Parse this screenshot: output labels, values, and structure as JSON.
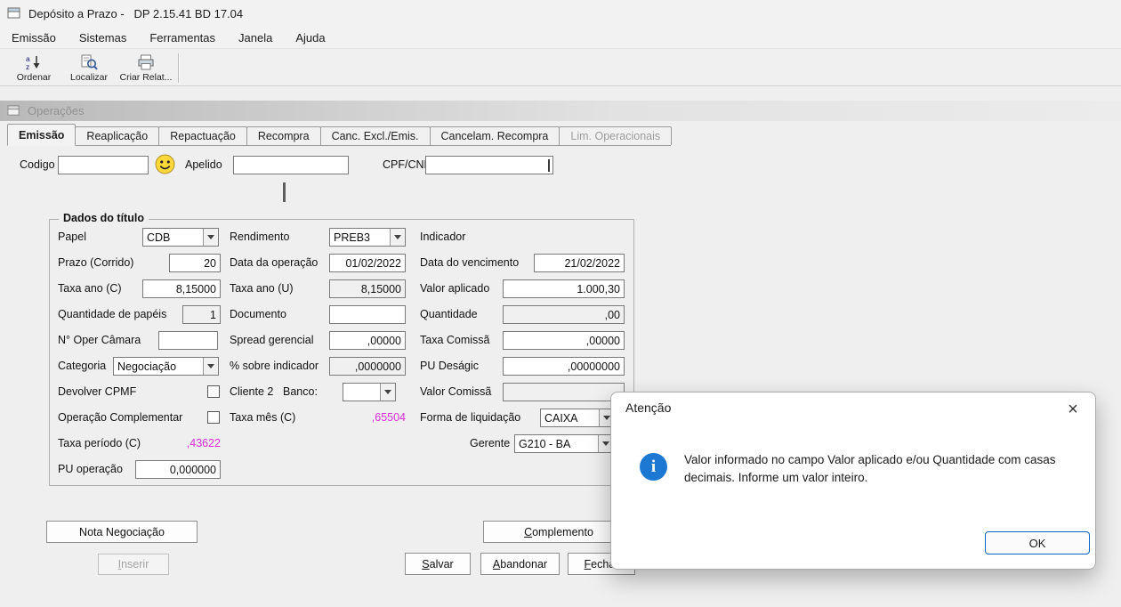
{
  "titlebar": {
    "title": "Depósito a Prazo -   DP 2.15.41 BD 17.04"
  },
  "menubar": {
    "items": [
      "Emissão",
      "Sistemas",
      "Ferramentas",
      "Janela",
      "Ajuda"
    ]
  },
  "toolbar": {
    "buttons": [
      "Ordenar",
      "Localizar",
      "Criar Relat..."
    ]
  },
  "operacoes": {
    "title": "Operações",
    "tabs": [
      "Emissão",
      "Reaplicação",
      "Repactuação",
      "Recompra",
      "Canc. Excl./Emis.",
      "Cancelam. Recompra",
      "Lim. Operacionais"
    ]
  },
  "header": {
    "codigo": {
      "label": "Codigo",
      "value": ""
    },
    "apelido": {
      "label": "Apelido",
      "value": ""
    },
    "cpf_cnpj": {
      "label": "CPF/CNPJ",
      "value": ""
    }
  },
  "dados": {
    "group_title": "Dados do título",
    "papel": {
      "label": "Papel",
      "value": "CDB"
    },
    "rendimento": {
      "label": "Rendimento",
      "value": "PREB3"
    },
    "indicador_label": "Indicador",
    "prazo": {
      "label": "Prazo (Corrido)",
      "value": "20"
    },
    "data_operacao": {
      "label": "Data da operação",
      "value": "01/02/2022"
    },
    "data_vencimento": {
      "label": "Data do vencimento",
      "value": "21/02/2022"
    },
    "taxa_ano_c": {
      "label": "Taxa ano (C)",
      "value": "8,15000"
    },
    "taxa_ano_u": {
      "label": "Taxa ano (U)",
      "value": "8,15000"
    },
    "valor_aplicado": {
      "label": "Valor aplicado",
      "value": "1.000,30"
    },
    "quantidade_papeis": {
      "label": "Quantidade de papéis",
      "value": "1"
    },
    "documento": {
      "label": "Documento",
      "value": ""
    },
    "quantidade": {
      "label": "Quantidade",
      "value": ",00"
    },
    "oper_camara": {
      "label": "N° Oper Câmara",
      "value": ""
    },
    "spread_gerencial": {
      "label": "Spread gerencial",
      "value": ",00000"
    },
    "taxa_comissao": {
      "label": "Taxa Comissã",
      "value": ",00000"
    },
    "categoria": {
      "label": "Categoria",
      "value": "Negociação"
    },
    "sobre_indicador": {
      "label": "% sobre indicador",
      "value": ",0000000"
    },
    "pu_desagio": {
      "label": "PU Deságic",
      "value": ",00000000"
    },
    "devolver_cpmf": {
      "label": "Devolver CPMF",
      "checked": false
    },
    "cliente2_label": "Cliente 2",
    "banco": {
      "label": "Banco:",
      "value": ""
    },
    "valor_comissao": {
      "label": "Valor Comissã",
      "value": ""
    },
    "operacao_complementar": {
      "label": "Operação Complementar",
      "checked": false
    },
    "taxa_mes": {
      "label": "Taxa mês (C)",
      "value": ",65504"
    },
    "forma_liquidacao": {
      "label": "Forma de liquidação",
      "value": "CAIXA"
    },
    "taxa_periodo": {
      "label": "Taxa período (C)",
      "value": ",43622"
    },
    "gerente": {
      "label": "Gerente",
      "value": "G210 - BA"
    },
    "pu_operacao": {
      "label": "PU operação",
      "value": "0,000000"
    }
  },
  "buttons": {
    "nota_negociacao": {
      "label": "Nota Negociação"
    },
    "inserir": {
      "mn": "I",
      "rest": "nserir"
    },
    "salvar": {
      "mn": "S",
      "rest": "alvar"
    },
    "abandonar": {
      "mn": "A",
      "rest": "bandonar"
    },
    "fechar": {
      "mn": "F",
      "rest": "echar"
    },
    "complemento": {
      "mn": "C",
      "rest": "omplemento"
    }
  },
  "dialog": {
    "title": "Atenção",
    "message": "Valor informado no campo Valor aplicado e/ou Quantidade com casas decimais. Informe um valor inteiro.",
    "ok_label": "OK",
    "close_glyph": "×",
    "info_glyph": "i"
  },
  "colors": {
    "accent_blue": "#0b67c2",
    "info_blue": "#1d78d4",
    "magenta_value": "#d92bd9"
  }
}
